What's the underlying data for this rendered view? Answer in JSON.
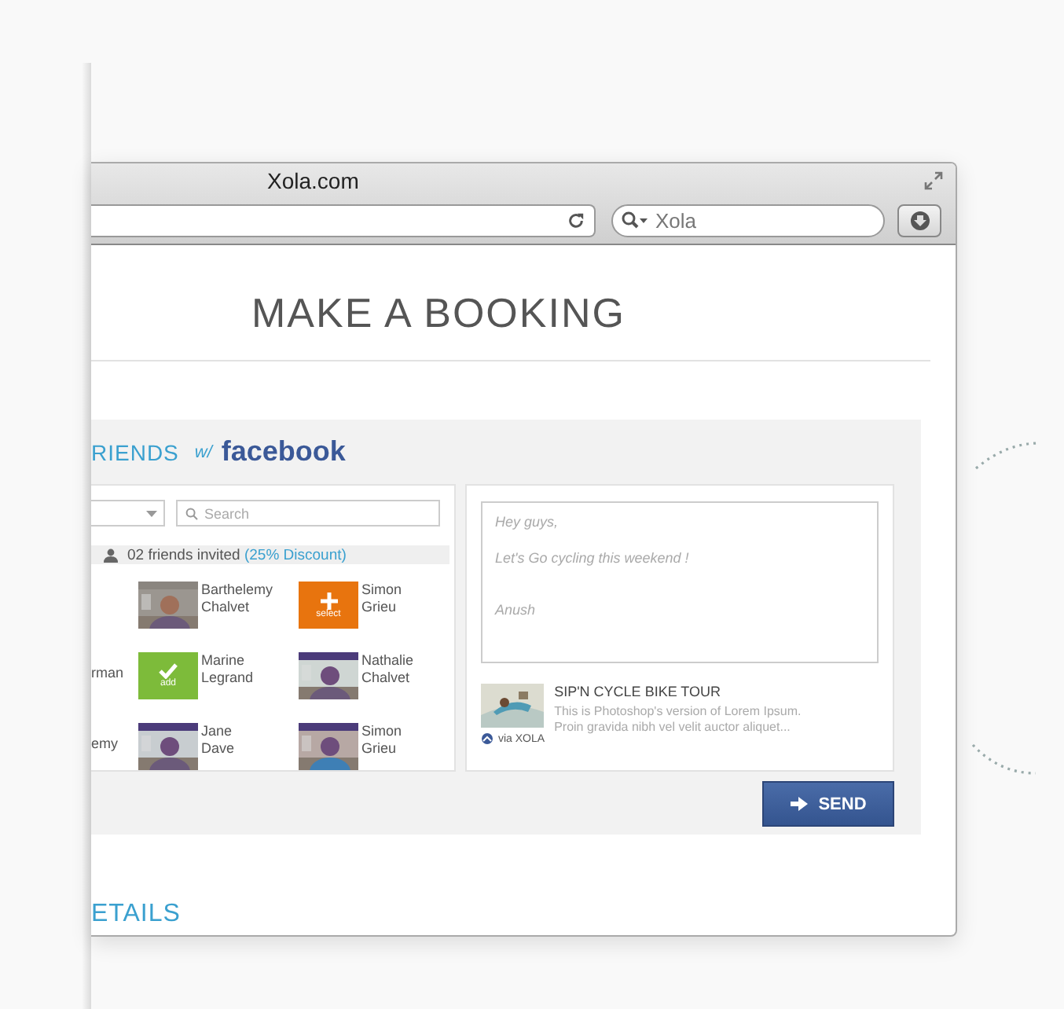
{
  "window": {
    "title": "Xola.com"
  },
  "toolbar": {
    "search_value": "Xola"
  },
  "page": {
    "heading": "MAKE A BOOKING",
    "invite": {
      "heading": "RIENDS",
      "with": "w/",
      "brand": "facebook",
      "search_placeholder": "Search",
      "invited": "02 friends invited",
      "discount": "(25% Discount)",
      "rows": [
        {
          "friends": [
            {
              "first": "Barthelemy",
              "last": "Chalvet"
            },
            {
              "kind": "select",
              "first": "Simon",
              "last": "Grieu",
              "action": "select"
            }
          ]
        },
        {
          "cut_name": "rman",
          "friends": [
            {
              "kind": "add",
              "first": "Marine",
              "last": "Legrand",
              "action": "add"
            },
            {
              "first": "Nathalie",
              "last": "Chalvet"
            }
          ]
        },
        {
          "cut_name": "emy",
          "friends": [
            {
              "first": "Jane",
              "last": "Dave"
            },
            {
              "first": "Simon",
              "last": "Grieu"
            }
          ]
        }
      ],
      "message": [
        "Hey guys,",
        "Let's Go cycling this weekend !",
        "Anush"
      ],
      "share": {
        "title": "SIP'N CYCLE BIKE TOUR",
        "description": "This is Photoshop's version of Lorem Ipsum. Proin gravida nibh vel velit auctor aliquet...",
        "via": "via XOLA"
      },
      "send": "SEND"
    },
    "details": "ETAILS"
  }
}
